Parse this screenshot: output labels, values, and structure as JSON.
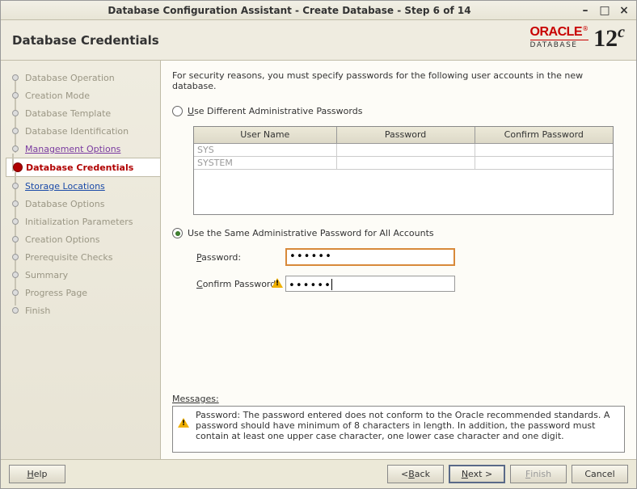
{
  "window": {
    "title": "Database Configuration Assistant - Create Database - Step 6 of 14"
  },
  "header": {
    "title": "Database Credentials",
    "brand": "ORACLE",
    "brand_sub": "DATABASE",
    "version_main": "12",
    "version_sup": "c"
  },
  "steps": [
    {
      "label": "Database Operation",
      "state": "disabled"
    },
    {
      "label": "Creation Mode",
      "state": "disabled"
    },
    {
      "label": "Database Template",
      "state": "disabled"
    },
    {
      "label": "Database Identification",
      "state": "disabled"
    },
    {
      "label": "Management Options",
      "state": "visited"
    },
    {
      "label": "Database Credentials",
      "state": "current"
    },
    {
      "label": "Storage Locations",
      "state": "next"
    },
    {
      "label": "Database Options",
      "state": "disabled"
    },
    {
      "label": "Initialization Parameters",
      "state": "disabled"
    },
    {
      "label": "Creation Options",
      "state": "disabled"
    },
    {
      "label": "Prerequisite Checks",
      "state": "disabled"
    },
    {
      "label": "Summary",
      "state": "disabled"
    },
    {
      "label": "Progress Page",
      "state": "disabled"
    },
    {
      "label": "Finish",
      "state": "disabled"
    }
  ],
  "main": {
    "intro": "For security reasons, you must specify passwords for the following user accounts in the new database.",
    "opt_diff": "Use Different Administrative Passwords",
    "opt_diff_mn": "U",
    "grid": {
      "cols": [
        "User Name",
        "Password",
        "Confirm Password"
      ],
      "rows": [
        {
          "user": "SYS",
          "pw": "",
          "cpw": ""
        },
        {
          "user": "SYSTEM",
          "pw": "",
          "cpw": ""
        }
      ]
    },
    "opt_same": "Use the Same Administrative Password for All Accounts",
    "opt_same_checked": true,
    "password_label": "Password:",
    "password_mn": "P",
    "password_value": "••••••",
    "confirm_label": "Confirm Password:",
    "confirm_mn": "C",
    "confirm_value": "••••••",
    "messages_label": "Messages:",
    "messages_mn": "M",
    "messages_text": "Password: The password entered does not conform to the Oracle recommended standards. A password should have minimum of 8 characters in length. In addition, the password must contain at least one upper case character, one lower case character and one digit."
  },
  "footer": {
    "help": "Help",
    "help_mn": "H",
    "back": "Back",
    "back_mn": "B",
    "next": "Next",
    "next_mn": "N",
    "finish": "Finish",
    "finish_mn": "F",
    "cancel": "Cancel"
  }
}
